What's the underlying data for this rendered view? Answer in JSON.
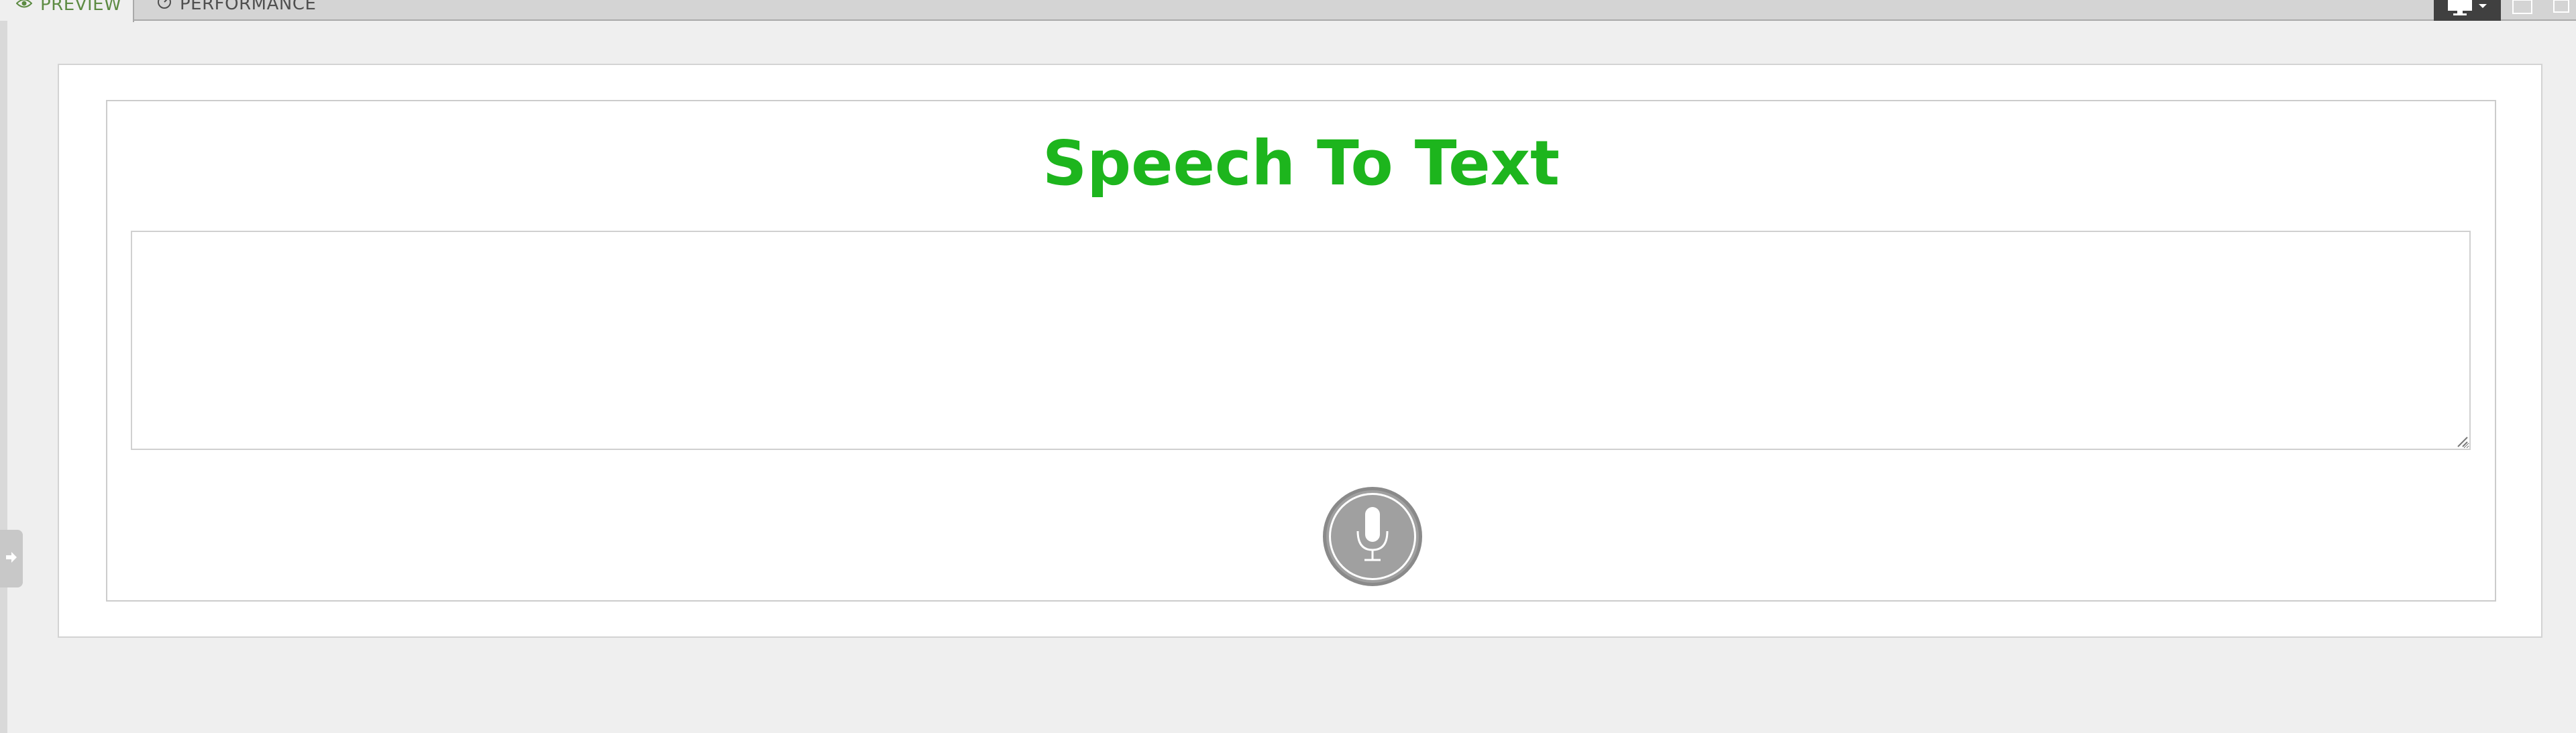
{
  "tabs": [
    {
      "label": "PREVIEW",
      "icon": "eye-icon",
      "active": true
    },
    {
      "label": "PERFORMANCE",
      "icon": "speedometer-icon",
      "active": false
    }
  ],
  "toolbar": {
    "device_icon": "desktop-icon",
    "expand_icon": "square-icon"
  },
  "preview": {
    "title": "Speech To Text",
    "textarea_value": "",
    "mic_icon": "microphone-icon"
  },
  "colors": {
    "title_green": "#1db51d",
    "tab_active_text": "#5d8b43",
    "mic_gray": "#a0a0a0"
  }
}
